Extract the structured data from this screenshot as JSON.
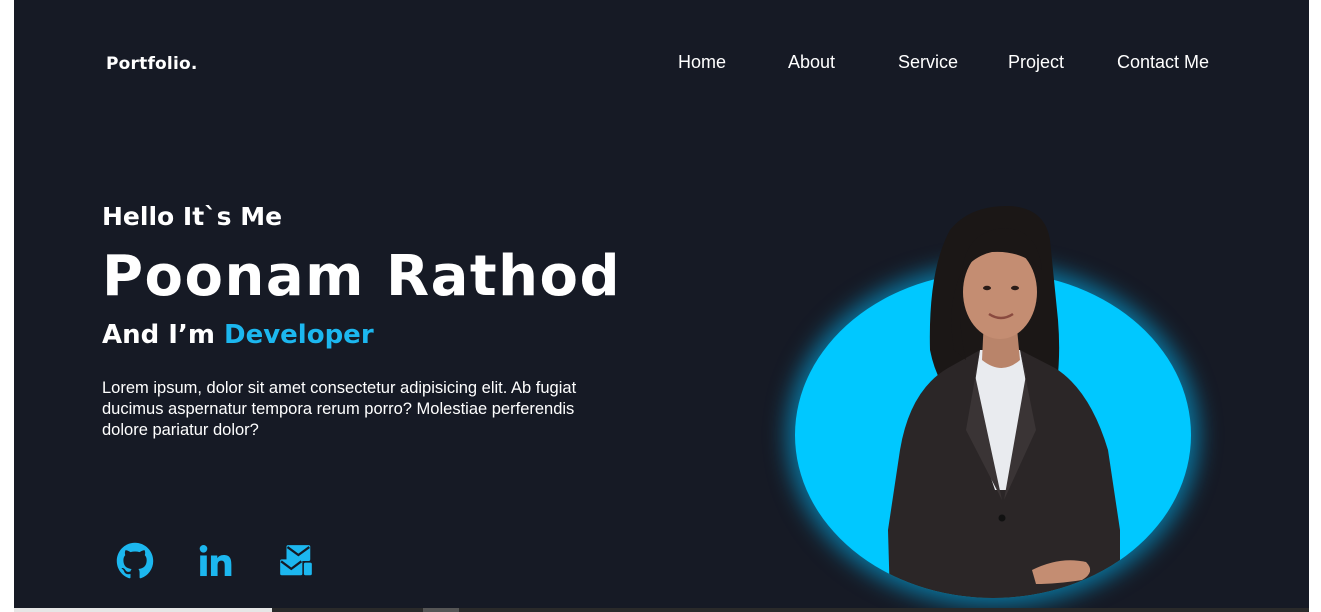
{
  "header": {
    "logo": "Portfolio.",
    "nav": [
      "Home",
      "About",
      "Service",
      "Project",
      "Contact Me"
    ]
  },
  "hero": {
    "greeting": "Hello It`s Me",
    "name": "Poonam Rathod",
    "role_prefix": "And I’m ",
    "role_accent": "Developer",
    "description": "Lorem ipsum, dolor sit amet consectetur adipisicing elit. Ab fugiat ducimus aspernatur tempora rerum porro? Molestiae  perferendis dolore pariatur dolor?"
  },
  "social": [
    {
      "icon": "github-icon"
    },
    {
      "icon": "linkedin-icon"
    },
    {
      "icon": "mail-icon"
    }
  ],
  "colors": {
    "background": "#161a25",
    "accent": "#1cb7ef",
    "glow": "#00c8ff",
    "text": "#ffffff"
  }
}
